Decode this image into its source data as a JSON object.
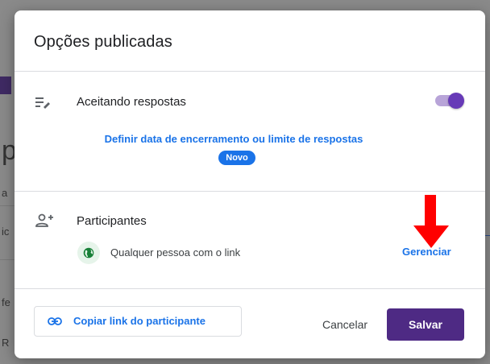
{
  "background_page": {
    "letters": [
      "p",
      "a",
      "ic",
      "fe",
      "R"
    ]
  },
  "dialog": {
    "title": "Opções publicadas",
    "responses": {
      "icon": "edit-lines-icon",
      "label": "Aceitando respostas",
      "toggle_on": true,
      "deadline_link": "Definir data de encerramento ou limite de respostas",
      "badge": "Novo"
    },
    "participants": {
      "icon": "person-add-icon",
      "label": "Participantes",
      "access_icon": "globe-icon",
      "access_text": "Qualquer pessoa com o link",
      "manage_label": "Gerenciar"
    },
    "footer": {
      "copy_icon": "link-icon",
      "copy_label": "Copiar link do participante",
      "cancel_label": "Cancelar",
      "save_label": "Salvar"
    }
  },
  "annotation": {
    "icon": "red-down-arrow-icon",
    "color": "#ff0000"
  },
  "colors": {
    "accent": "#673ab7",
    "save_button": "#4e2a84",
    "link": "#1a73e8",
    "globe_bg": "#e6f4ea",
    "globe": "#188038"
  }
}
